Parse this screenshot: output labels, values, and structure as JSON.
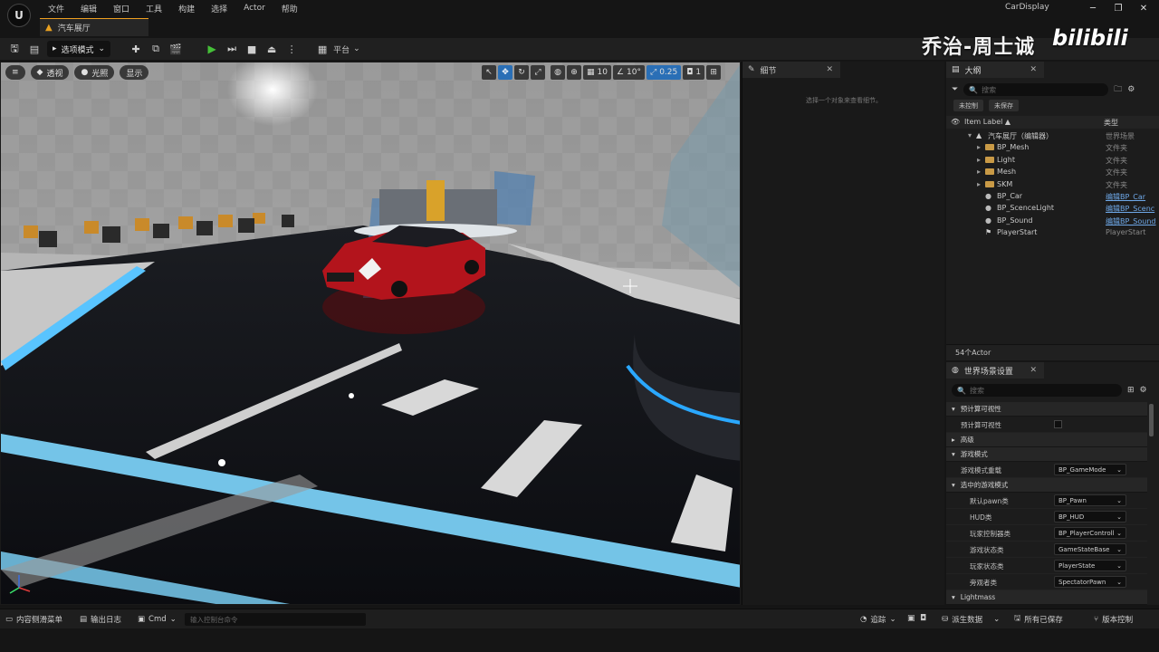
{
  "menu": [
    "文件",
    "编辑",
    "窗口",
    "工具",
    "构建",
    "选择",
    "Actor",
    "帮助"
  ],
  "map_tab": "汽车展厅",
  "project_name": "CarDisplay",
  "watermark": {
    "text": "乔治-周士诚",
    "brand": "bilibili"
  },
  "toolbar": {
    "mode_label": "选项模式",
    "platform_label": "平台"
  },
  "viewport": {
    "view_mode": "透视",
    "lighting": "光照",
    "show": "显示",
    "grid_size": "10",
    "rot_snap": "10°",
    "scale_snap": "0.25",
    "cam_speed": "1"
  },
  "details": {
    "tab": "细节",
    "empty_msg": "选择一个对象来查看细节。"
  },
  "outliner": {
    "tab": "大纲",
    "search_placeholder": "搜索",
    "chips": [
      "未控制",
      "未保存"
    ],
    "col_label": "Item Label ▲",
    "col_type": "类型",
    "rows": [
      {
        "label": "汽车展厅（编辑器）",
        "type": "世界场景",
        "indent": 0,
        "kind": "world",
        "link": false
      },
      {
        "label": "BP_Mesh",
        "type": "文件夹",
        "indent": 1,
        "kind": "folder",
        "link": false
      },
      {
        "label": "Light",
        "type": "文件夹",
        "indent": 1,
        "kind": "folder",
        "link": false
      },
      {
        "label": "Mesh",
        "type": "文件夹",
        "indent": 1,
        "kind": "folder",
        "link": false
      },
      {
        "label": "SKM",
        "type": "文件夹",
        "indent": 1,
        "kind": "folder",
        "link": false
      },
      {
        "label": "BP_Car",
        "type": "编辑BP_Car",
        "indent": 1,
        "kind": "actor",
        "link": true
      },
      {
        "label": "BP_ScenceLight",
        "type": "编辑BP_Scenc",
        "indent": 1,
        "kind": "actor",
        "link": true
      },
      {
        "label": "BP_Sound",
        "type": "编辑BP_Sound",
        "indent": 1,
        "kind": "actor",
        "link": true
      },
      {
        "label": "PlayerStart",
        "type": "PlayerStart",
        "indent": 1,
        "kind": "start",
        "link": false
      }
    ],
    "count": "54个Actor"
  },
  "world_settings": {
    "tab": "世界场景设置",
    "search_placeholder": "搜索",
    "items": [
      {
        "kind": "section",
        "label": "预计算可视性",
        "open": true
      },
      {
        "kind": "check",
        "label": "预计算可视性"
      },
      {
        "kind": "section",
        "label": "高级",
        "open": false
      },
      {
        "kind": "section",
        "label": "游戏模式",
        "open": true
      },
      {
        "kind": "dropdown",
        "label": "游戏模式重载",
        "value": "BP_GameMode",
        "indent": 0
      },
      {
        "kind": "section",
        "label": "选中的游戏模式",
        "open": true
      },
      {
        "kind": "dropdown",
        "label": "默认pawn类",
        "value": "BP_Pawn",
        "indent": 1
      },
      {
        "kind": "dropdown",
        "label": "HUD类",
        "value": "BP_HUD",
        "indent": 1
      },
      {
        "kind": "dropdown",
        "label": "玩家控制器类",
        "value": "BP_PlayerControll",
        "indent": 1
      },
      {
        "kind": "dropdown",
        "label": "游戏状态类",
        "value": "GameStateBase",
        "indent": 1
      },
      {
        "kind": "dropdown",
        "label": "玩家状态类",
        "value": "PlayerState",
        "indent": 1
      },
      {
        "kind": "dropdown",
        "label": "旁观者类",
        "value": "SpectatorPawn",
        "indent": 1
      },
      {
        "kind": "section",
        "label": "Lightmass",
        "open": true
      }
    ]
  },
  "status": {
    "content_drawer": "内容侧滑菜单",
    "output_log": "输出日志",
    "cmd": "Cmd",
    "cmd_placeholder": "输入控制台命令",
    "trace": "追踪",
    "derived_data": "派生数据",
    "all_saved": "所有已保存",
    "source_control": "版本控制"
  }
}
